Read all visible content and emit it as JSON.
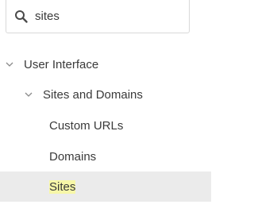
{
  "search": {
    "value": "sites",
    "placeholder": ""
  },
  "icons": {
    "search": "search-icon",
    "expanded": "chevron-down-icon"
  },
  "tree": {
    "user_interface": {
      "label": "User Interface",
      "expanded": true
    },
    "sites_and_domains": {
      "label": "Sites and Domains",
      "expanded": true
    },
    "custom_urls": {
      "label": "Custom URLs"
    },
    "domains": {
      "label": "Domains"
    },
    "sites": {
      "label": "Sites",
      "selected": true,
      "match": "Sites"
    }
  },
  "colors": {
    "selected_row": "#ebebeb",
    "match_highlight": "#f7f7a8",
    "text": "#3a3a3a",
    "border": "#d9d9d9"
  }
}
